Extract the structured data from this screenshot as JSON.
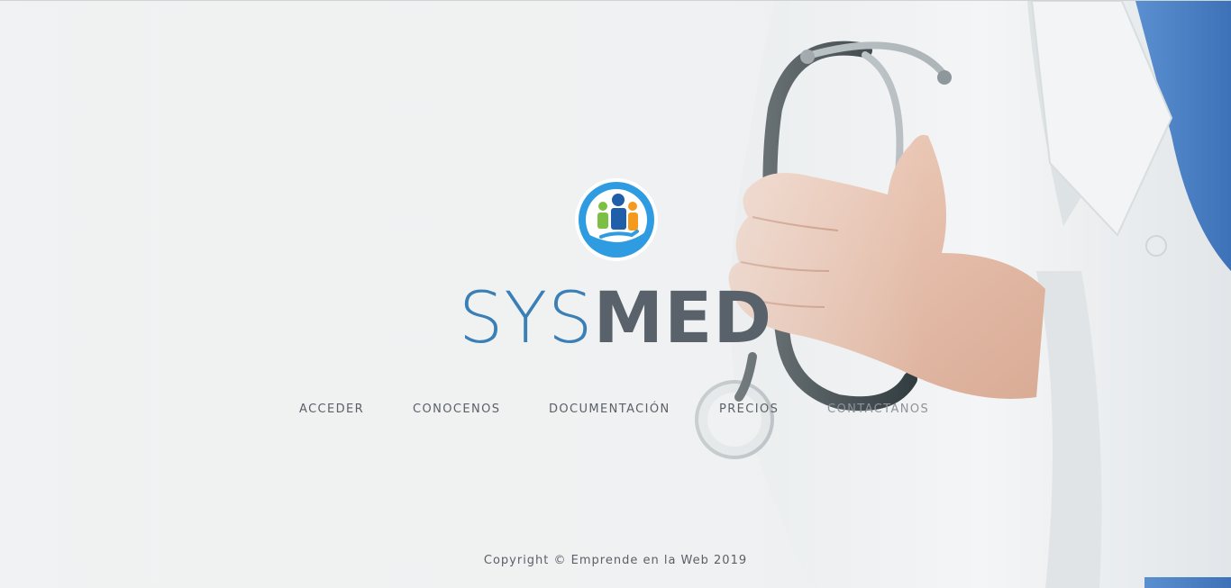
{
  "brand": {
    "part1": "SYS",
    "part2": "MED",
    "colors": {
      "sys": "#3a7fb5",
      "med": "#59626a",
      "logo_ring": "#2f9be0"
    }
  },
  "nav": {
    "items": [
      {
        "label": "ACCEDER"
      },
      {
        "label": "CONOCENOS"
      },
      {
        "label": "DOCUMENTACIÓN"
      },
      {
        "label": "PRECIOS"
      },
      {
        "label": "CONTACTANOS"
      }
    ]
  },
  "footer": {
    "copyright": "Copyright © Emprende en la Web 2019"
  },
  "background": {
    "image": "doctor-holding-stethoscope"
  }
}
